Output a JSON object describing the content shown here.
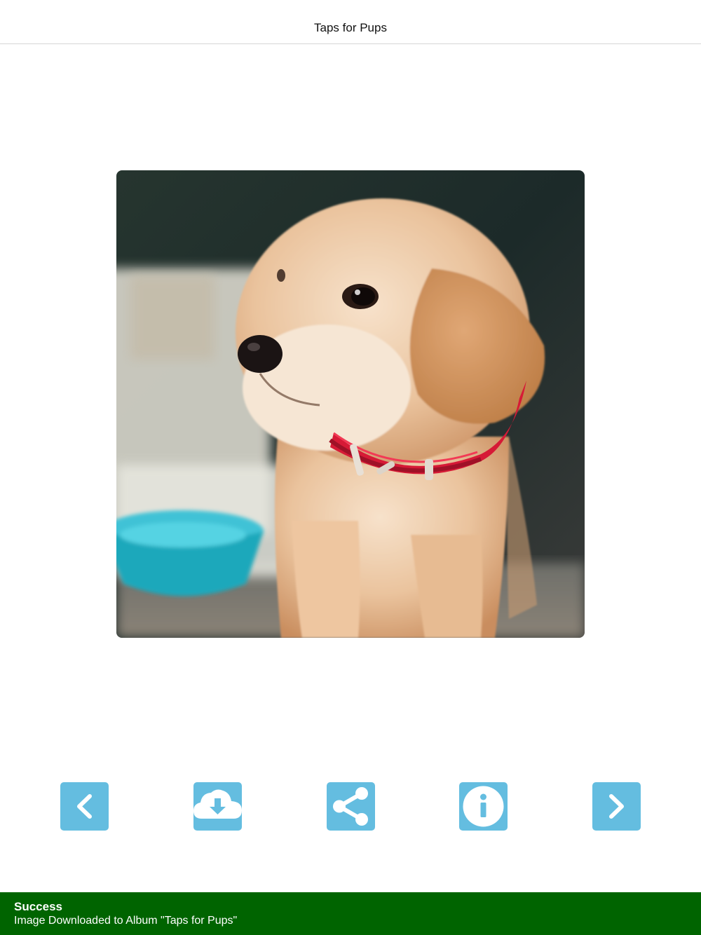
{
  "app": {
    "title": "Taps for Pups"
  },
  "photo": {
    "subject": "Golden retriever puppy with red collar"
  },
  "toolbar": {
    "accent": "#64bde0",
    "buttons": [
      {
        "id": "previous",
        "icon": "chevron-left-icon"
      },
      {
        "id": "download",
        "icon": "cloud-download-icon"
      },
      {
        "id": "share",
        "icon": "share-icon"
      },
      {
        "id": "info",
        "icon": "info-icon"
      },
      {
        "id": "next",
        "icon": "chevron-right-icon"
      }
    ]
  },
  "toast": {
    "color": "#006400",
    "title": "Success",
    "message": "Image Downloaded to Album \"Taps for Pups\""
  }
}
